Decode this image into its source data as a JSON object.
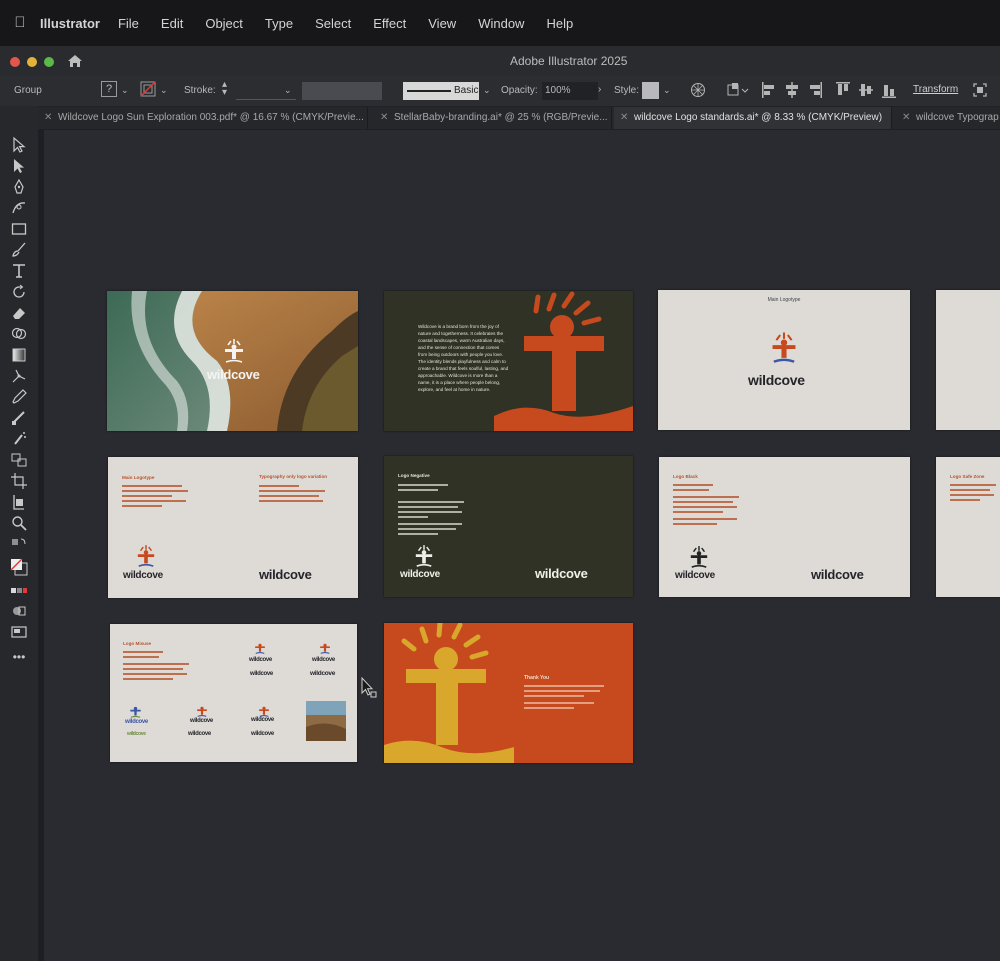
{
  "menubar": {
    "apple": "",
    "app_name": "Illustrator",
    "items": [
      "File",
      "Edit",
      "Object",
      "Type",
      "Select",
      "Effect",
      "View",
      "Window",
      "Help"
    ]
  },
  "window": {
    "title": "Adobe Illustrator 2025"
  },
  "controlbar": {
    "group_label": "Group",
    "fill_glyph": "?",
    "stroke_label": "Stroke:",
    "brush_label": "Basic",
    "opacity_label": "Opacity:",
    "opacity_value": "100%",
    "style_label": "Style:",
    "transform_label": "Transform"
  },
  "tabs": [
    {
      "label": "Wildcove Logo Sun Exploration 003.pdf* @ 16.67 % (CMYK/Previe...",
      "active": false
    },
    {
      "label": "StellarBaby-branding.ai* @ 25 % (RGB/Previe...",
      "active": false
    },
    {
      "label": "wildcove Logo standards.ai* @ 8.33 % (CMYK/Preview)",
      "active": true
    },
    {
      "label": "wildcove Typograp",
      "active": false
    }
  ],
  "artboards": {
    "wordmark": "wildcove",
    "slide2_text": [
      "Wildcove is a brand born from the joy of",
      "nature and togetherness. It celebrates the",
      "coastal landscapes, warm Australian days,",
      "and the sense of connection that comes",
      "from being outdoors with people you love.",
      "The identity blends playfulness and calm to",
      "create a brand that feels soulful, lasting, and",
      "approachable. Wildcove is more than a",
      "name, it is a place where people belong,",
      "explore, and feel at home in nature."
    ],
    "slide3_title": "Main Logotype",
    "slide4_title_left": "Main Logotype",
    "slide4_title_right": "Typography only logo variation",
    "slide5_title": "Logo Negative",
    "slide6_title": "Logo Black",
    "slide7_title": "Logo Safe Zone",
    "slide8_title": "Logo Misuse",
    "slide9_title": "Thank You"
  },
  "colors": {
    "accent_orange": "#c64a1e",
    "sun_yellow": "#d9a72c",
    "dark_green": "#2f3224",
    "paper": "#dedbd6"
  }
}
